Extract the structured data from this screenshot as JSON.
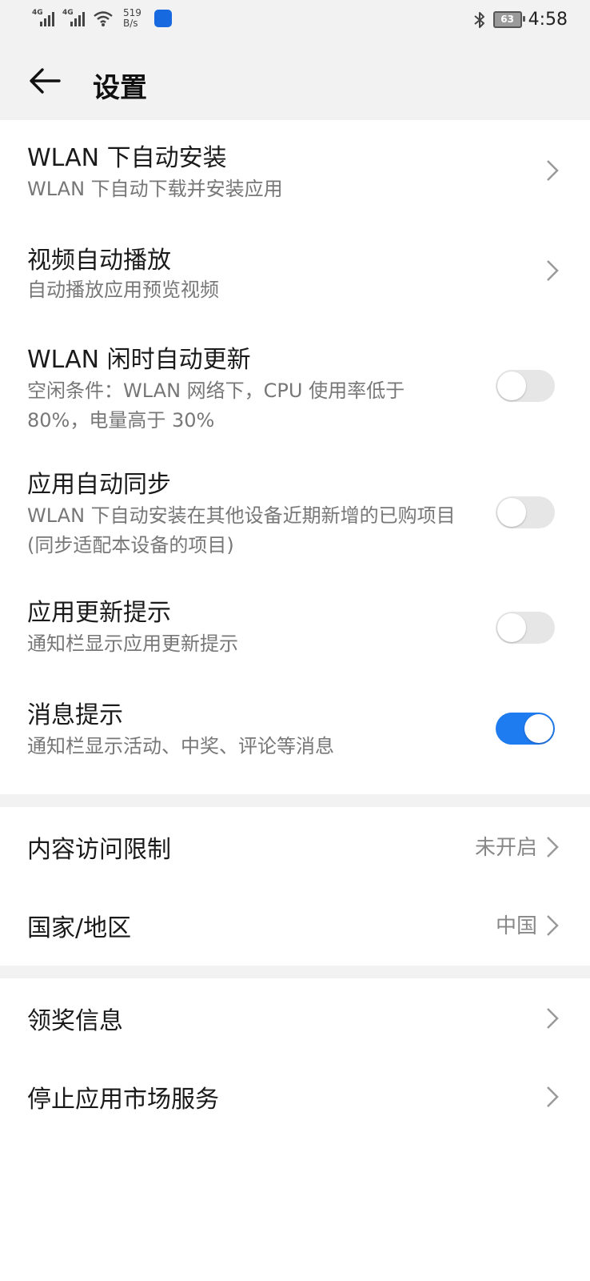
{
  "status_bar": {
    "net1": "4G",
    "net2": "4G",
    "speed_value": "519",
    "speed_unit": "B/s",
    "battery": "63",
    "time": "4:58"
  },
  "header": {
    "title": "设置"
  },
  "items": [
    {
      "title": "WLAN 下自动安装",
      "subtitle": "WLAN 下自动下载并安装应用",
      "control": "chevron"
    },
    {
      "title": "视频自动播放",
      "subtitle": "自动播放应用预览视频",
      "control": "chevron"
    },
    {
      "title": "WLAN 闲时自动更新",
      "subtitle": "空闲条件：WLAN 网络下，CPU 使用率低于 80%，电量高于 30%",
      "control": "toggle",
      "on": false
    },
    {
      "title": "应用自动同步",
      "subtitle": "WLAN 下自动安装在其他设备近期新增的已购项目 (同步适配本设备的项目)",
      "control": "toggle",
      "on": false
    },
    {
      "title": "应用更新提示",
      "subtitle": "通知栏显示应用更新提示",
      "control": "toggle",
      "on": false
    },
    {
      "title": "消息提示",
      "subtitle": "通知栏显示活动、中奖、评论等消息",
      "control": "toggle",
      "on": true
    }
  ],
  "group2": [
    {
      "title": "内容访问限制",
      "value": "未开启"
    },
    {
      "title": "国家/地区",
      "value": "中国"
    }
  ],
  "group3": [
    {
      "title": "领奖信息"
    },
    {
      "title": "停止应用市场服务"
    }
  ],
  "colors": {
    "toggle_on": "#1f7bf0",
    "toggle_off": "#e6e6e6",
    "section_bg": "#f2f2f2"
  }
}
